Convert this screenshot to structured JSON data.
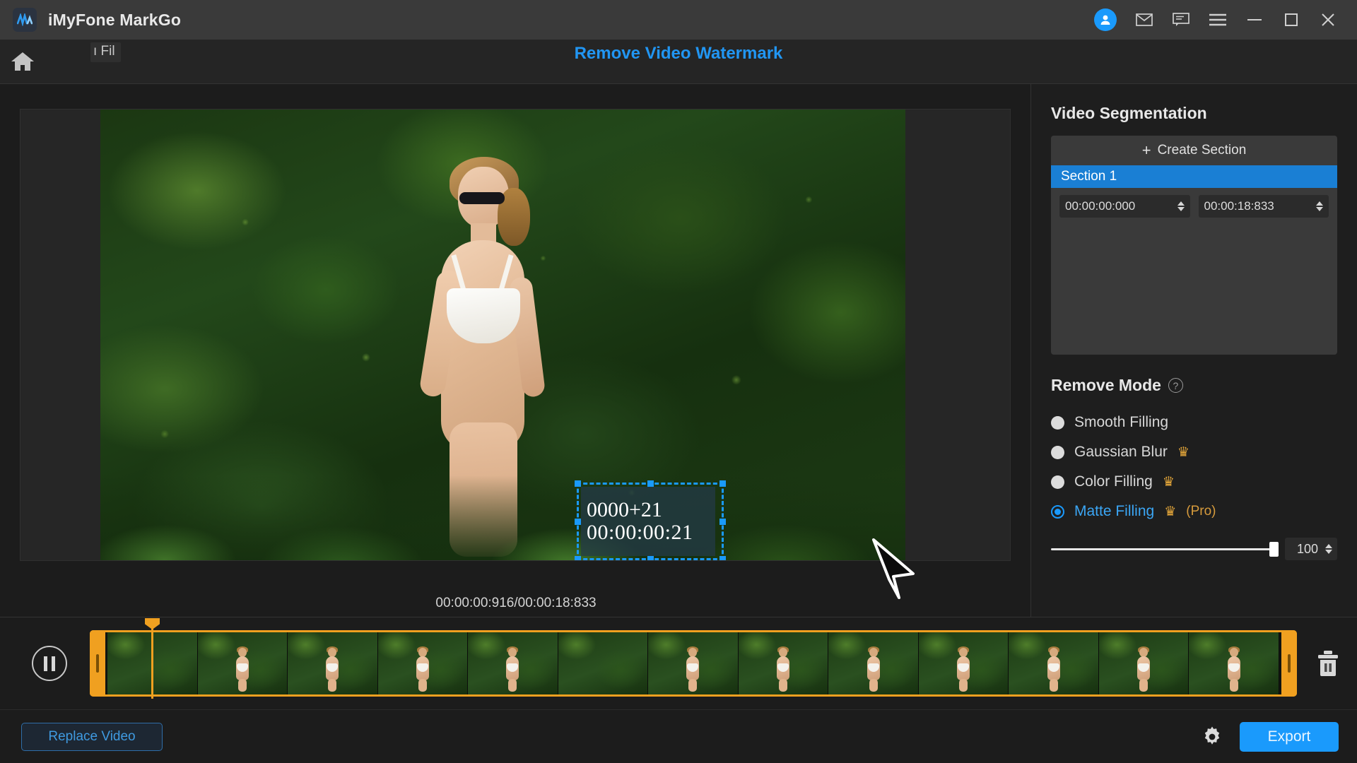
{
  "titlebar": {
    "app_name": "iMyFone MarkGo",
    "logo_icon": "markgo-logo",
    "icons": [
      {
        "name": "account-avatar-icon",
        "glyph": "user"
      },
      {
        "name": "mail-icon",
        "glyph": "envelope"
      },
      {
        "name": "feedback-icon",
        "glyph": "chat"
      },
      {
        "name": "menu-icon",
        "glyph": "hamburger"
      },
      {
        "name": "minimize-icon",
        "glyph": "minus"
      },
      {
        "name": "maximize-icon",
        "glyph": "square"
      },
      {
        "name": "close-icon",
        "glyph": "x"
      }
    ]
  },
  "header": {
    "home_icon": "home-icon",
    "file_hint": "ı Fil",
    "title": "Remove Video Watermark"
  },
  "preview": {
    "watermark_line1": "0000+21",
    "watermark_line2": "00:00:00:21",
    "time_readout": "00:00:00:916/00:00:18:833"
  },
  "panel": {
    "segmentation_title": "Video Segmentation",
    "create_section_label": "Create Section",
    "create_section_icon": "plus-icon",
    "sections": [
      {
        "name": "Section 1",
        "start": "00:00:00:000",
        "end": "00:00:18:833"
      }
    ],
    "remove_mode_title": "Remove Mode",
    "help_icon": "question-mark-icon",
    "modes": [
      {
        "label": "Smooth Filling",
        "selected": false,
        "pro": false,
        "crown": false,
        "suffix": ""
      },
      {
        "label": "Gaussian Blur",
        "selected": false,
        "pro": false,
        "crown": true,
        "suffix": ""
      },
      {
        "label": "Color Filling",
        "selected": false,
        "pro": false,
        "crown": true,
        "suffix": ""
      },
      {
        "label": "Matte Filling",
        "selected": true,
        "pro": true,
        "crown": true,
        "suffix": "(Pro)"
      }
    ],
    "crown_glyph": "♛",
    "slider_value": "100",
    "slider_percent": 100
  },
  "timeline": {
    "play_pause_icon": "pause-icon",
    "delete_icon": "trash-icon",
    "trim_left_icon": "trim-handle-left",
    "trim_right_icon": "trim-handle-right",
    "playhead_icon": "playhead-marker"
  },
  "bottombar": {
    "replace_label": "Replace Video",
    "settings_icon": "gear-icon",
    "export_label": "Export"
  },
  "colors": {
    "accent_blue": "#1a9afc",
    "title_blue": "#2196f3",
    "timeline_orange": "#f0a020",
    "crown_gold": "#e8a93a",
    "selection_blue": "#1a7fd4"
  }
}
